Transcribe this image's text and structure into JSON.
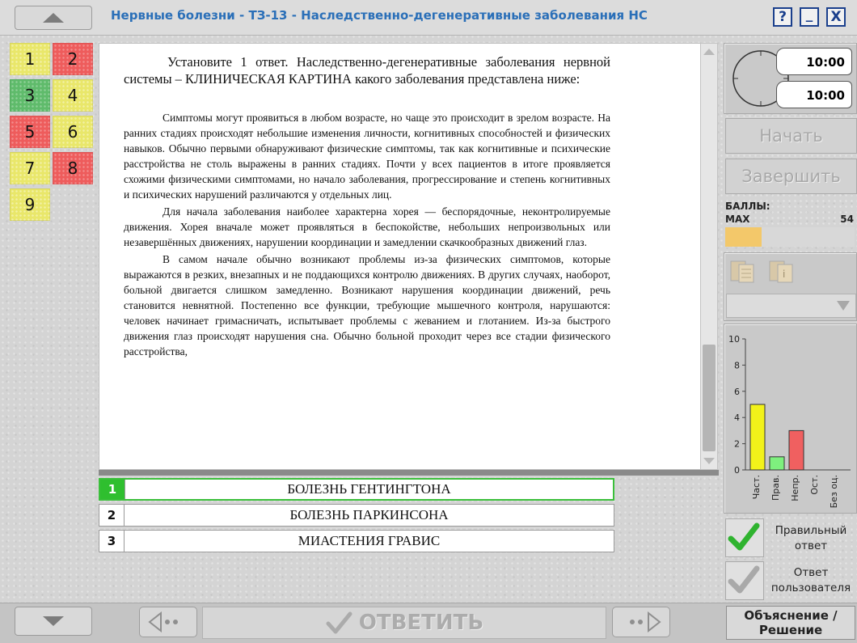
{
  "window": {
    "title": "Нервные болезни - ТЗ-13 - Наследственно-дегенеративные заболевания НС",
    "help_label": "?",
    "minimize_label": "_",
    "close_label": "X"
  },
  "questions": [
    {
      "label": "1",
      "status": "yellow"
    },
    {
      "label": "2",
      "status": "red"
    },
    {
      "label": "3",
      "status": "green"
    },
    {
      "label": "4",
      "status": "yellow"
    },
    {
      "label": "5",
      "status": "red"
    },
    {
      "label": "6",
      "status": "yellow"
    },
    {
      "label": "7",
      "status": "yellow"
    },
    {
      "label": "8",
      "status": "red"
    },
    {
      "label": "9",
      "status": "yellow"
    }
  ],
  "content": {
    "intro": "Установите 1 ответ. Наследственно-дегенеративные заболевания нервной системы – КЛИНИЧЕСКАЯ КАРТИНА какого заболевания представлена ниже:",
    "paragraphs": [
      "Симптомы могут проявиться в любом возрасте, но чаще это происходит в зрелом возрасте. На ранних стадиях происходят небольшие изменения личности, когнитивных способностей и физических навыков. Обычно первыми обнаруживают физические симптомы, так как когнитивные и психические расстройства не столь выражены в ранних стадиях. Почти у всех пациентов в итоге проявляется схожими физическими симптомами, но начало заболевания, прогрессирование и степень когнитивных и психических нарушений различаются у отдельных лиц.",
      "Для начала заболевания наиболее характерна хорея — беспорядочные, неконтролируемые движения. Хорея вначале может проявляться в беспокойстве, небольших непроизвольных или незавершённых движениях, нарушении координации и замедлении скачкообразных движений глаз.",
      "В самом начале обычно возникают проблемы из-за физических симптомов, которые выражаются в резких, внезапных и не поддающихся контролю движениях. В других случаях, наоборот, больной двигается слишком замедленно. Возникают нарушения координации движений, речь становится невнятной. Постепенно все функции, требующие мышечного контроля, нарушаются: человек начинает гримасничать, испытывает проблемы с жеванием и глотанием. Из-за быстрого движения глаз происходят нарушения сна. Обычно больной проходит через все стадии физического расстройства,"
    ]
  },
  "answers": [
    {
      "num": "1",
      "text": "БОЛЕЗНЬ ГЕНТИНГТОНА",
      "selected": true
    },
    {
      "num": "2",
      "text": "БОЛЕЗНЬ ПАРКИНСОНА",
      "selected": false
    },
    {
      "num": "3",
      "text": "МИАСТЕНИЯ ГРАВИС",
      "selected": false
    }
  ],
  "timer": {
    "time1": "10:00",
    "time2": "10:00"
  },
  "buttons": {
    "start": "Начать",
    "finish": "Завершить",
    "answer": "ОТВЕТИТЬ",
    "explanation": "Объяснение /\nРешение"
  },
  "score": {
    "label": "БАЛЛЫ:",
    "max_label": "MAX",
    "max_value": "54",
    "progress_fraction": 0.28
  },
  "legend": {
    "correct": "Правильный ответ",
    "user": "Ответ пользователя"
  },
  "chart_data": {
    "type": "bar",
    "categories": [
      "Част.",
      "Прав.",
      "Непр.",
      "Ост.",
      "Без оц."
    ],
    "values": [
      5,
      1,
      3,
      0,
      0
    ],
    "colors": [
      "#f2f21a",
      "#7ef07e",
      "#f06060",
      "#cccccc",
      "#cccccc"
    ],
    "ylim": [
      0,
      10
    ],
    "yticks": [
      "0",
      "2",
      "4",
      "6",
      "8",
      "10"
    ]
  },
  "colors": {
    "title": "#2a6fb8",
    "score_bar": "#f3c86a",
    "selected_answer": "#2fbf2f"
  }
}
